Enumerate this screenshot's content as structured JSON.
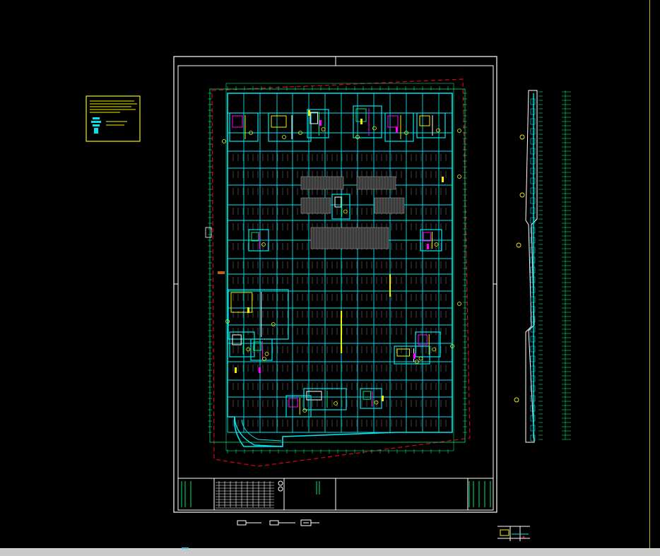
{
  "app": {
    "type": "CAD drawing viewer",
    "background": "#000000"
  },
  "colors": {
    "sheet_border": "#ffffff",
    "grid_lines": "#00e6ee",
    "dimension_lines": "#00e676",
    "boundary_dash": "#e0001b",
    "highlight": "#f2f200",
    "annotation": "#ff00ff",
    "status_bar": "#c9c9c9",
    "right_rule": "#c8b400"
  },
  "icons": {
    "legend": "legend-box-icon",
    "section": "section-strip-icon",
    "scale_bars": "scale-bar-icon"
  }
}
